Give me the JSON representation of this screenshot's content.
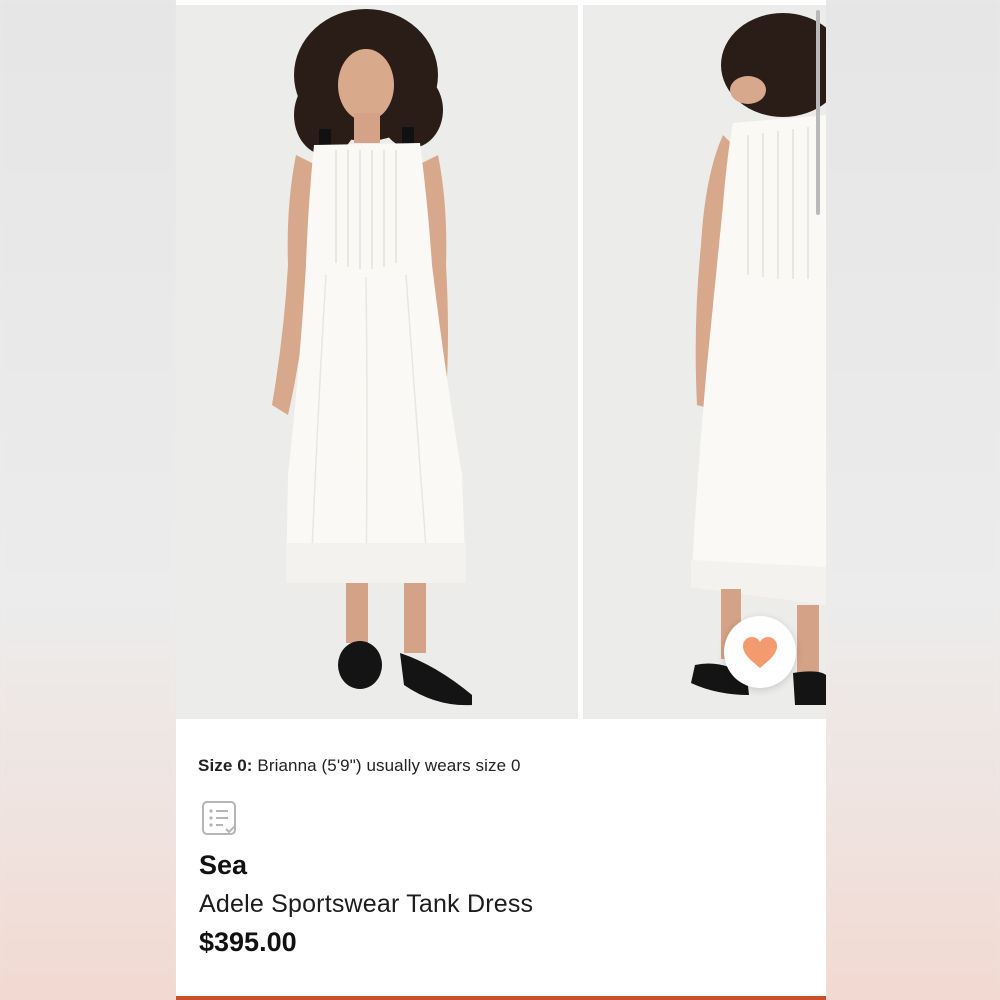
{
  "product": {
    "size_label": "Size 0:",
    "size_text": " Brianna (5'9\") usually wears size 0",
    "brand": "Sea",
    "name": "Adele Sportswear Tank Dress",
    "price": "$395.00"
  },
  "icons": {
    "favorite": "heart-icon",
    "size_guide": "size-guide-list-icon"
  },
  "colors": {
    "heart": "#f39a70",
    "accent_bar": "#c8512b",
    "text": "#111111"
  }
}
